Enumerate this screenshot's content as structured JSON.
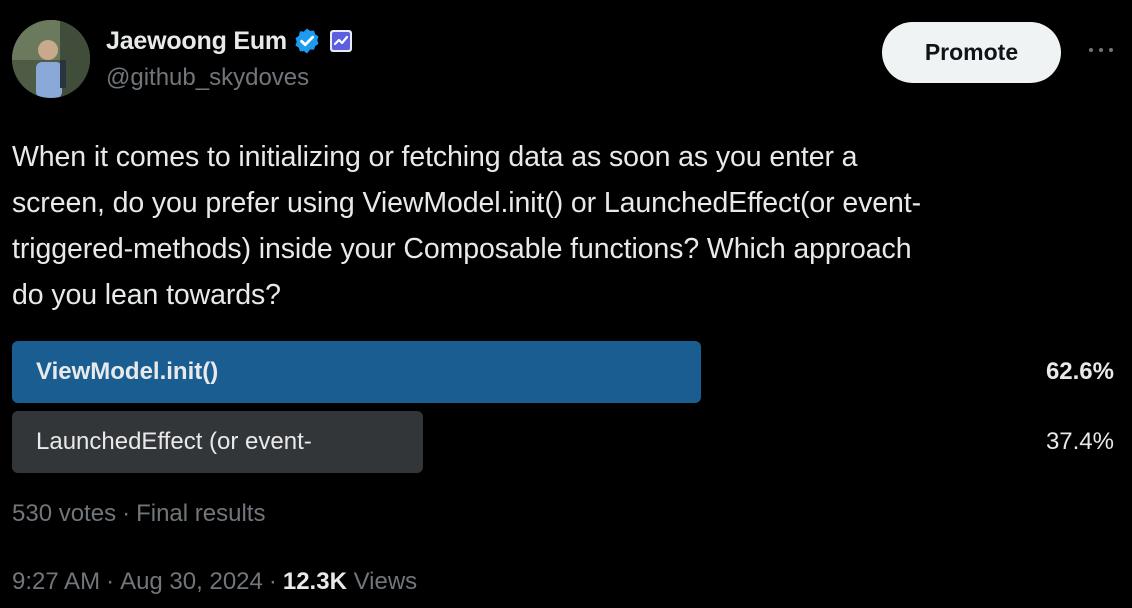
{
  "author": {
    "display_name": "Jaewoong Eum",
    "handle": "@github_skydoves",
    "verified_icon": "verified-badge-icon",
    "affiliate_icon": "affiliate-badge-icon"
  },
  "actions": {
    "promote_label": "Promote",
    "more_icon": "more-horizontal-icon"
  },
  "tweet": {
    "text_lines": [
      "When it comes to initializing or fetching data as soon as you enter a",
      "screen, do you prefer using ViewModel.init() or LaunchedEffect(or event-",
      "triggered-methods) inside your Composable functions? Which approach",
      "do you lean towards?"
    ]
  },
  "poll": {
    "options": [
      {
        "label": "ViewModel.init()",
        "percent_text": "62.6%",
        "share": 0.626,
        "winner": true
      },
      {
        "label": "LaunchedEffect (or event-",
        "percent_text": "37.4%",
        "share": 0.374,
        "winner": false
      }
    ],
    "votes": "530 votes",
    "status": "Final results",
    "separator": "·"
  },
  "footer": {
    "time": "9:27 AM",
    "date": "Aug 30, 2024",
    "views_count": "12.3K",
    "views_label": "Views",
    "separator": "·"
  },
  "colors": {
    "background": "#000000",
    "text_primary": "#e7e9ea",
    "text_secondary": "#71767b",
    "verified_blue": "#1d9bf0",
    "poll_winner_bar": "#1a5e91",
    "poll_loser_bar": "#333639",
    "promote_bg": "#eff3f4"
  }
}
